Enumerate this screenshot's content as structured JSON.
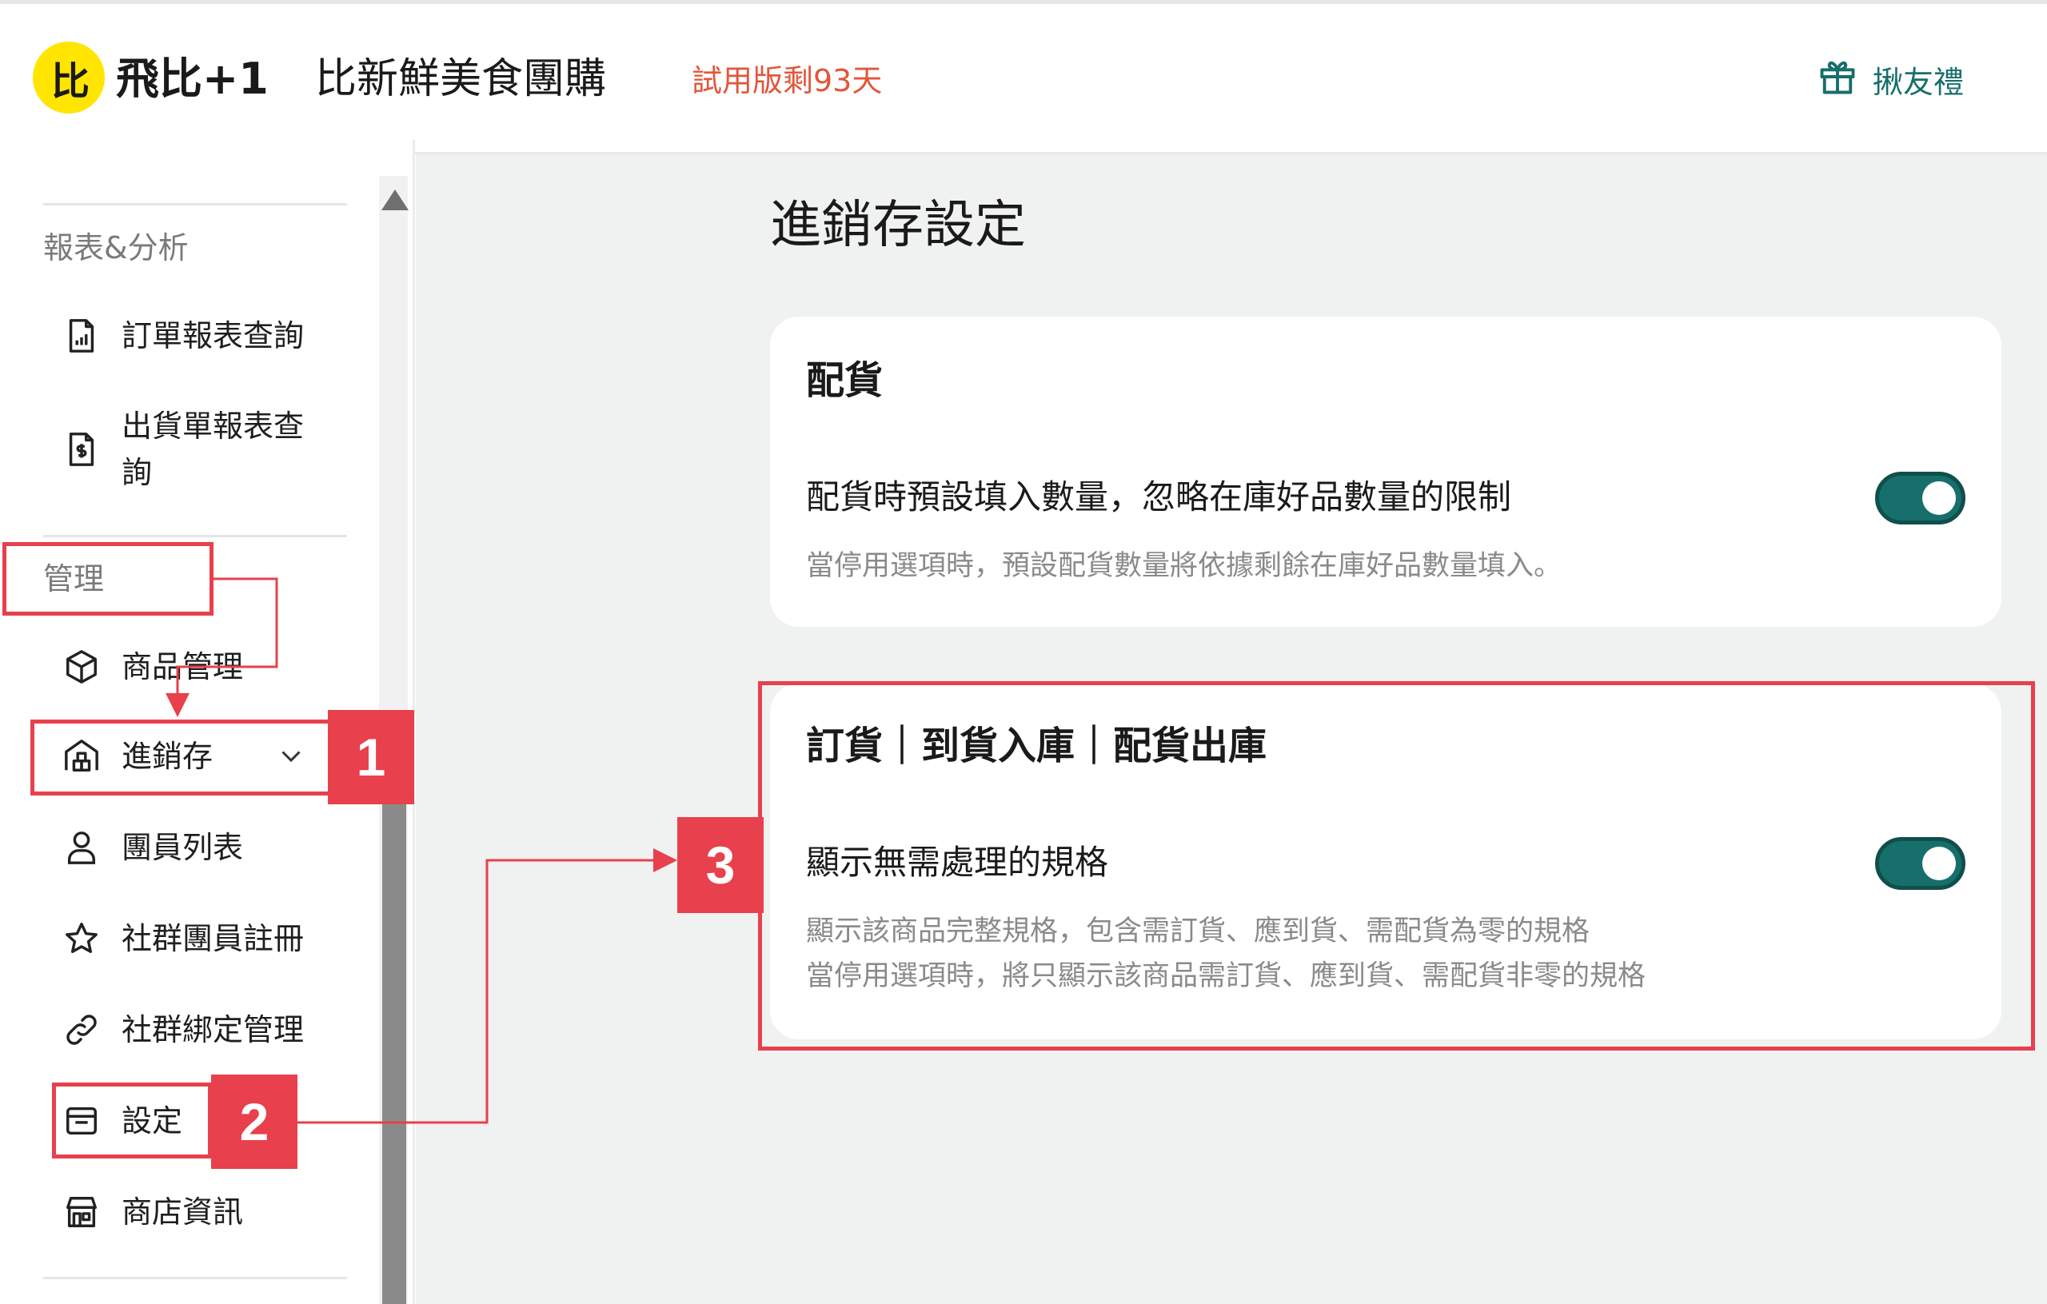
{
  "header": {
    "logo_mark": "比",
    "logo_text": "飛比+1",
    "shop_name": "比新鮮美食團購",
    "trial_text": "試用版剩93天",
    "gift_label": "揪友禮"
  },
  "sidebar": {
    "groups": [
      {
        "label": "報表&分析"
      },
      {
        "label": "管理"
      }
    ],
    "items": [
      {
        "label": "訂單報表查詢",
        "icon": "report-file-icon"
      },
      {
        "label": "出貨單報表查\n詢",
        "icon": "invoice-file-icon"
      },
      {
        "label": "商品管理",
        "icon": "box-icon"
      },
      {
        "label": "進銷存",
        "icon": "warehouse-icon",
        "expanded": true
      },
      {
        "label": "團員列表",
        "icon": "user-icon"
      },
      {
        "label": "社群團員註冊",
        "icon": "star-icon"
      },
      {
        "label": "社群綁定管理",
        "icon": "link-icon"
      },
      {
        "label": "設定",
        "icon": "settings-window-icon"
      },
      {
        "label": "商店資訊",
        "icon": "store-icon"
      }
    ]
  },
  "main": {
    "page_title": "進銷存設定",
    "cards": [
      {
        "title": "配貨",
        "setting_label": "配貨時預設填入數量，忽略在庫好品數量的限制",
        "setting_desc": "當停用選項時，預設配貨數量將依據剩餘在庫好品數量填入。",
        "enabled": true
      },
      {
        "title": "訂貨｜到貨入庫｜配貨出庫",
        "setting_label": "顯示無需處理的規格",
        "setting_desc": "顯示該商品完整規格，包含需訂貨、應到貨、需配貨為零的規格\n當停用選項時，將只顯示該商品需訂貨、應到貨、需配貨非零的規格",
        "enabled": true
      }
    ]
  },
  "annotations": {
    "step1": "1",
    "step2": "2",
    "step3": "3",
    "color": "#e8404c"
  },
  "colors": {
    "accent": "#176f6b",
    "trial": "#e2563b",
    "logo": "#ffe500"
  }
}
